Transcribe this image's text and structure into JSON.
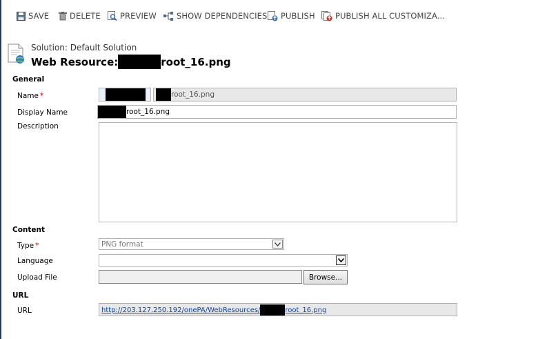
{
  "toolbar": {
    "save": "SAVE",
    "delete": "DELETE",
    "preview": "PREVIEW",
    "show_dependencies": "SHOW DEPENDENCIES",
    "publish": "PUBLISH",
    "publish_all": "PUBLISH ALL CUSTOMIZA..."
  },
  "header": {
    "solution": "Solution: Default Solution",
    "web_resource_prefix": "Web Resource:",
    "web_resource_suffix": "root_16.png"
  },
  "sections": {
    "general": "General",
    "content": "Content",
    "url": "URL"
  },
  "fields": {
    "name_label": "Name",
    "name_value_suffix": "root_16.png",
    "display_name_label": "Display Name",
    "display_name_value_suffix": "root_16.png",
    "description_label": "Description",
    "description_value": "",
    "type_label": "Type",
    "type_value": "PNG format",
    "language_label": "Language",
    "language_value": "",
    "upload_label": "Upload File",
    "upload_value": "",
    "browse_label": "Browse...",
    "url_label": "URL",
    "url_prefix": "http://203.127.250.192/onePA/WebResources/",
    "url_suffix": "root_16.png"
  },
  "required_marker": "*"
}
